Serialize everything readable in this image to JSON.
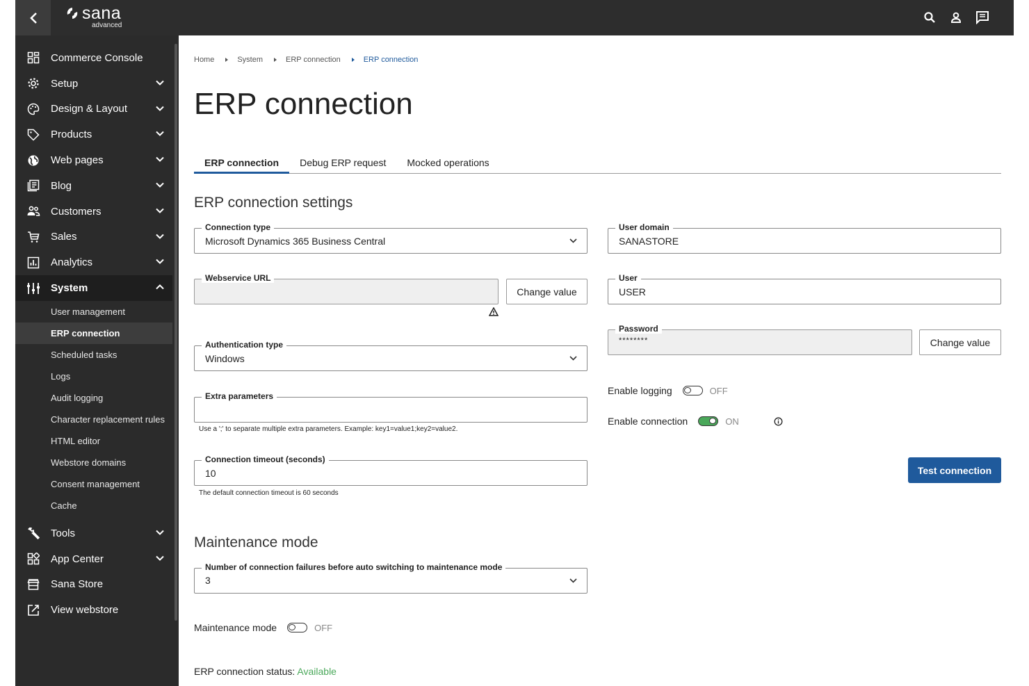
{
  "brand": {
    "name": "sana",
    "sub": "advanced"
  },
  "sidebar": {
    "items": [
      {
        "label": "Commerce Console",
        "icon": "dashboard-icon",
        "chevron": ""
      },
      {
        "label": "Setup",
        "icon": "gear-icon",
        "chevron": "down"
      },
      {
        "label": "Design & Layout",
        "icon": "palette-icon",
        "chevron": "down"
      },
      {
        "label": "Products",
        "icon": "tag-icon",
        "chevron": "down"
      },
      {
        "label": "Web pages",
        "icon": "globe-icon",
        "chevron": "down"
      },
      {
        "label": "Blog",
        "icon": "blog-icon",
        "chevron": "down"
      },
      {
        "label": "Customers",
        "icon": "customers-icon",
        "chevron": "down"
      },
      {
        "label": "Sales",
        "icon": "cart-icon",
        "chevron": "down"
      },
      {
        "label": "Analytics",
        "icon": "analytics-icon",
        "chevron": "down"
      },
      {
        "label": "System",
        "icon": "system-icon",
        "chevron": "up"
      }
    ],
    "system_subitems": [
      "User management",
      "ERP connection",
      "Scheduled tasks",
      "Logs",
      "Audit logging",
      "Character replacement rules",
      "HTML editor",
      "Webstore domains",
      "Consent management",
      "Cache"
    ],
    "bottom_items": [
      {
        "label": "Tools",
        "icon": "wrench-icon",
        "chevron": "down"
      },
      {
        "label": "App Center",
        "icon": "apps-icon",
        "chevron": "down"
      },
      {
        "label": "Sana Store",
        "icon": "store-icon",
        "chevron": ""
      },
      {
        "label": "View webstore",
        "icon": "external-link-icon",
        "chevron": ""
      }
    ]
  },
  "breadcrumb": [
    "Home",
    "System",
    "ERP connection",
    "ERP connection"
  ],
  "page": {
    "title": "ERP connection"
  },
  "tabs": [
    "ERP connection",
    "Debug ERP request",
    "Mocked operations"
  ],
  "settings": {
    "heading": "ERP connection settings",
    "connection_type": {
      "label": "Connection type",
      "value": "Microsoft Dynamics 365 Business Central"
    },
    "webservice_url": {
      "label": "Webservice URL",
      "value": ""
    },
    "change_value_label": "Change value",
    "authentication_type": {
      "label": "Authentication type",
      "value": "Windows"
    },
    "extra_parameters": {
      "label": "Extra parameters",
      "value": "",
      "help": "Use a ';' to separate multiple extra parameters. Example: key1=value1;key2=value2."
    },
    "connection_timeout": {
      "label": "Connection timeout (seconds)",
      "value": "10",
      "help": "The default connection timeout is 60 seconds"
    },
    "user_domain": {
      "label": "User domain",
      "value": "SANASTORE"
    },
    "user": {
      "label": "User",
      "value": "USER"
    },
    "password": {
      "label": "Password",
      "value": "********"
    },
    "enable_logging": {
      "label": "Enable logging",
      "state": "OFF"
    },
    "enable_connection": {
      "label": "Enable connection",
      "state": "ON"
    },
    "test_connection_label": "Test connection"
  },
  "maintenance": {
    "heading": "Maintenance mode",
    "failures": {
      "label": "Number of connection failures before auto switching to maintenance mode",
      "value": "3"
    },
    "mode": {
      "label": "Maintenance mode",
      "state": "OFF"
    }
  },
  "status": {
    "label": "ERP connection status:",
    "value": "Available"
  },
  "colors": {
    "accent": "#1f5a9c",
    "success": "#4aa85a",
    "sidebar": "#2b2b2b",
    "topbar": "#2d2d2d"
  }
}
